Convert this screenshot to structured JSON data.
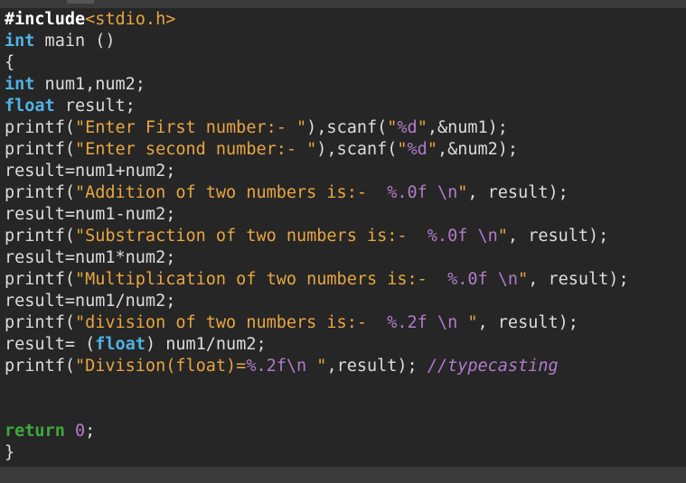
{
  "code": {
    "l1": {
      "pre": "#include",
      "hdr": "<stdio.h>"
    },
    "l2": {
      "kw": "int",
      "rest": " main ()"
    },
    "l3": {
      "text": "{"
    },
    "l4": {
      "kw": "int",
      "rest": " num1,num2;"
    },
    "l5": {
      "kw": "float",
      "rest": " result;"
    },
    "l6": {
      "a": "printf(",
      "s": "\"Enter First number:- \"",
      "b": "),scanf(",
      "s2a": "\"",
      "f": "%d",
      "s2b": "\"",
      "c": ",&num1);"
    },
    "l7": {
      "a": "printf(",
      "s": "\"Enter second number:- \"",
      "b": "),scanf(",
      "s2a": "\"",
      "f": "%d",
      "s2b": "\"",
      "c": ",&num2);"
    },
    "l8": {
      "text": "result=num1+num2;"
    },
    "l9": {
      "a": "printf(",
      "s": "\"Addition of two numbers is:-  ",
      "f": "%.0f",
      "sp": " ",
      "esc": "\\n",
      "q": "\"",
      "c": ", result);"
    },
    "l10": {
      "text": "result=num1-num2;"
    },
    "l11": {
      "a": "printf(",
      "s": "\"Substraction of two numbers is:-  ",
      "f": "%.0f",
      "sp": " ",
      "esc": "\\n",
      "q": "\"",
      "c": ", result);"
    },
    "l12": {
      "text": "result=num1*num2;"
    },
    "l13": {
      "a": "printf(",
      "s": "\"Multiplication of two numbers is:-  ",
      "f": "%.0f",
      "sp": " ",
      "esc": "\\n",
      "q": "\"",
      "c": ", result);"
    },
    "l14": {
      "text": "result=num1/num2;"
    },
    "l15": {
      "a": "printf(",
      "s": "\"division of two numbers is:-  ",
      "f": "%.2f",
      "sp": " ",
      "esc": "\\n",
      "q": " \"",
      "c": ", result);"
    },
    "l16": {
      "a": "result= (",
      "kw": "float",
      "b": ") num1/num2;"
    },
    "l17": {
      "a": "printf(",
      "s": "\"Division(float)=",
      "f": "%.2f",
      "esc": "\\n",
      "q": " \"",
      "c": ",result); ",
      "cmt": "//typecasting"
    },
    "l20": {
      "ret": "return",
      "sp": " ",
      "num": "0",
      "c": ";"
    },
    "l21": {
      "text": "}"
    }
  },
  "colors": {
    "background": "#262626",
    "keyword": "#4fb3e6",
    "return_keyword": "#3daa3d",
    "string": "#e8a640",
    "format_specifier": "#b07cc8",
    "comment": "#b07cc8",
    "plain": "#dcdcdc"
  }
}
